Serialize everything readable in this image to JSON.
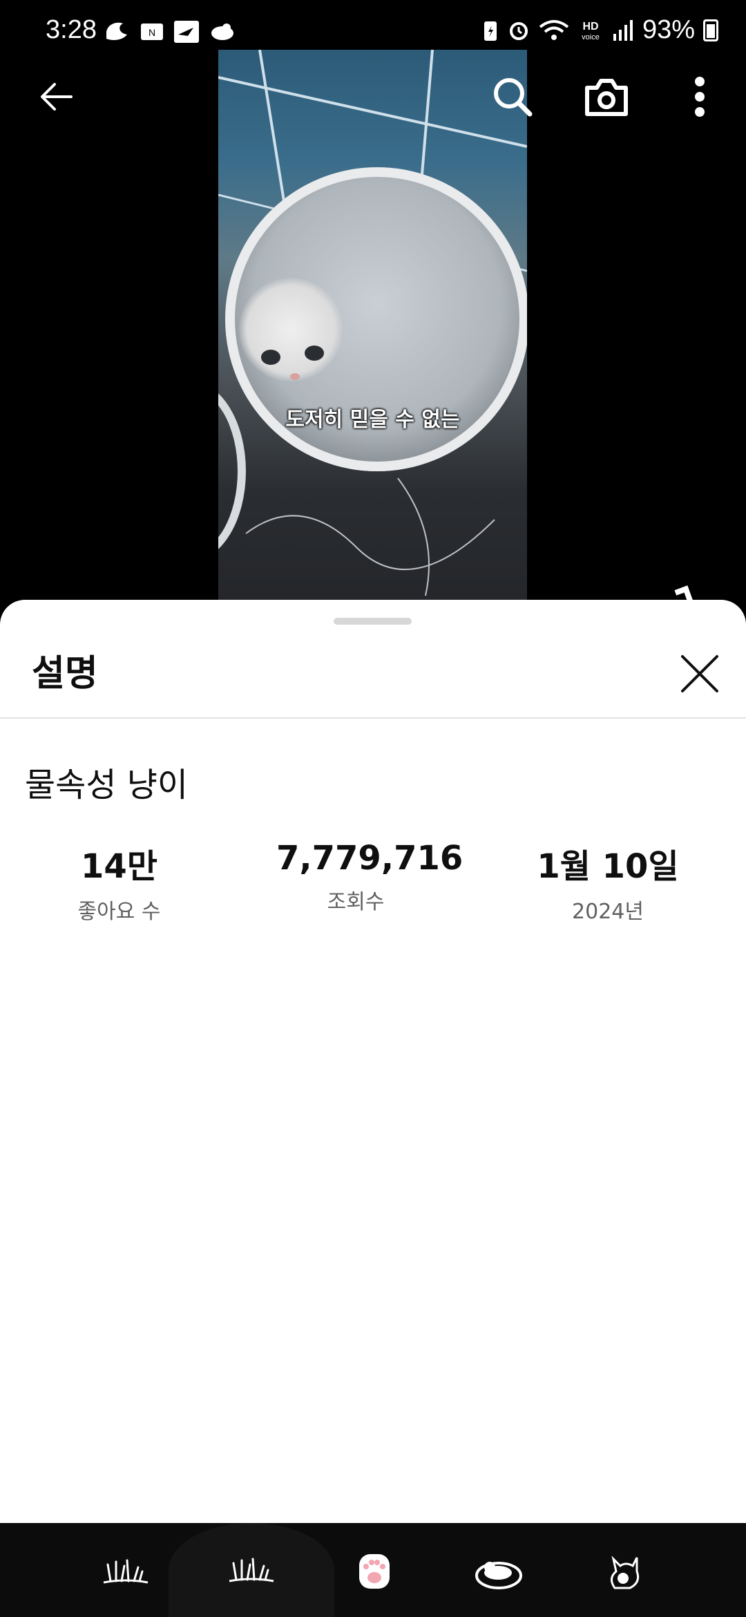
{
  "status_bar": {
    "time": "3:28",
    "battery": "93%",
    "left_icons": [
      "messenger-icon",
      "mail-icon",
      "app-icon",
      "cloud-icon"
    ],
    "right_icons": [
      "battery-saver-icon",
      "alarm-icon",
      "wifi-icon",
      "hd-voice-icon",
      "signal-icon"
    ]
  },
  "top_bar": {
    "back": "back-arrow-icon",
    "search": "search-icon",
    "camera": "camera-icon",
    "more": "more-vertical-icon"
  },
  "video": {
    "caption": "도저히 믿을 수 없는"
  },
  "sheet": {
    "title": "설명",
    "video_title": "물속성 냥이",
    "stats": {
      "likes_value": "14만",
      "likes_label": "좋아요 수",
      "views_value": "7,779,716",
      "views_label": "조회수",
      "date_value": "1월 10일",
      "date_label": "2024년"
    }
  },
  "bottom_bar": {
    "icons": [
      "grass-icon",
      "grass-icon",
      "paw-icon",
      "cat-bowl-icon",
      "cat-icon"
    ]
  }
}
